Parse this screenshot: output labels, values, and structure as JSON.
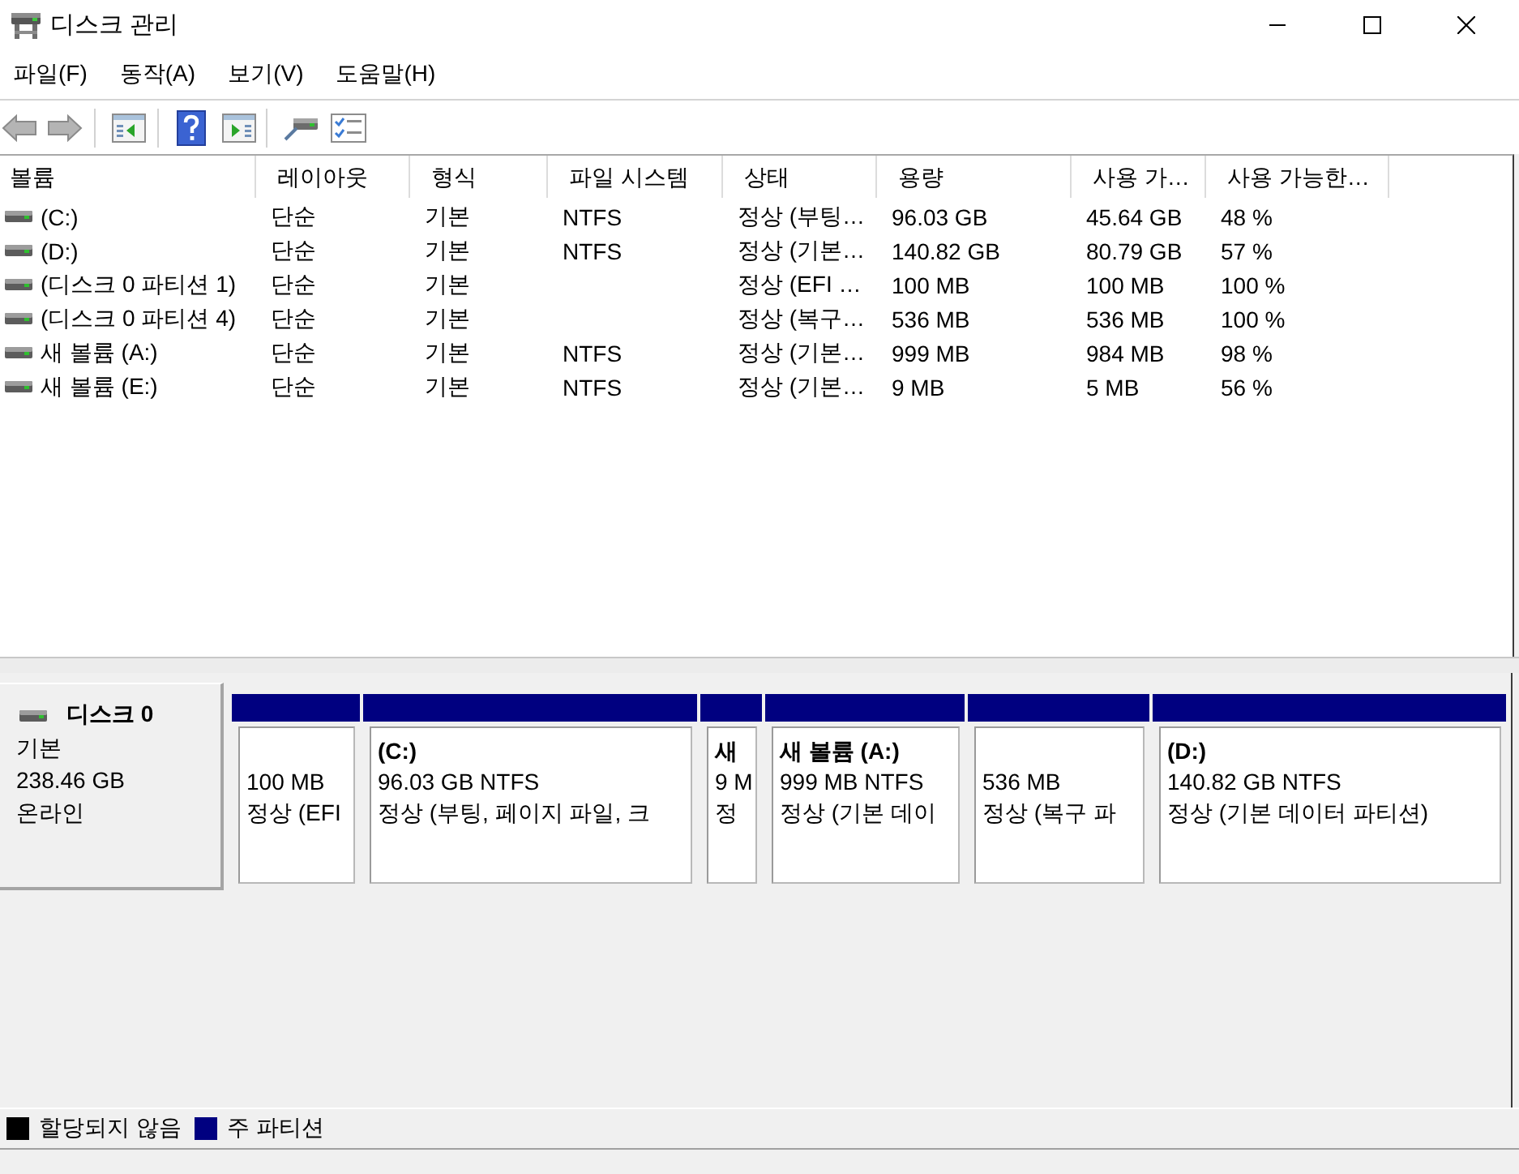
{
  "window": {
    "title": "디스크 관리"
  },
  "menu": [
    "파일(F)",
    "동작(A)",
    "보기(V)",
    "도움말(H)"
  ],
  "volume_table": {
    "columns": [
      "볼륨",
      "레이아웃",
      "형식",
      "파일 시스템",
      "상태",
      "용량",
      "사용 가…",
      "사용 가능한…"
    ],
    "rows": [
      {
        "volume": "(C:)",
        "layout": "단순",
        "type": "기본",
        "file_system": "NTFS",
        "status": "정상 (부팅…",
        "capacity": "96.03 GB",
        "column_7": "45.64 GB",
        "column_8": "48 %",
        "selected": false
      },
      {
        "volume": "(D:)",
        "layout": "단순",
        "type": "기본",
        "file_system": "NTFS",
        "status": "정상 (기본…",
        "capacity": "140.82 GB",
        "column_7": "80.79 GB",
        "column_8": "57 %",
        "selected": false
      },
      {
        "volume": "(디스크 0 파티션 1)",
        "layout": "단순",
        "type": "기본",
        "status": "정상 (EFI …",
        "capacity": "100 MB",
        "column_7": "100 MB",
        "column_8": "100 %",
        "selected": false
      },
      {
        "volume": "(디스크 0 파티션 4)",
        "layout": "단순",
        "type": "기본",
        "status": "정상 (복구…",
        "capacity": "536 MB",
        "column_7": "536 MB",
        "column_8": "100 %",
        "selected": false
      },
      {
        "volume": "새 볼륨 (A:)",
        "layout": "단순",
        "type": "기본",
        "file_system": "NTFS",
        "status": "정상 (기본…",
        "capacity": "999 MB",
        "column_7": "984 MB",
        "column_8": "98 %",
        "selected": false
      },
      {
        "volume": "새 볼륨 (E:)",
        "layout": "단순",
        "type": "기본",
        "file_system": "NTFS",
        "status": "정상 (기본…",
        "capacity": "9 MB",
        "column_7": "5 MB",
        "column_8": "56 %",
        "selected": false
      }
    ]
  },
  "disk": {
    "name": "디스크 0",
    "type": "기본",
    "size": "238.46 GB",
    "status": "온라인",
    "partitions": [
      {
        "kind": "primary",
        "size": "100 MB",
        "status": "정상 (EFI",
        "selected": false
      },
      {
        "kind": "primary",
        "label": "(C:)",
        "size": "96.03 GB NTFS",
        "status": "정상 (부팅, 페이지 파일, 크",
        "selected": false
      },
      {
        "kind": "primary",
        "label": "새",
        "size": "9 M",
        "status": "정",
        "selected": false
      },
      {
        "kind": "primary",
        "label": "새 볼륨 (A:)",
        "size": "999 MB NTFS",
        "status": "정상 (기본 데이",
        "selected": false
      },
      {
        "kind": "primary",
        "size": "536 MB",
        "status": "정상 (복구 파",
        "selected": false
      },
      {
        "kind": "primary",
        "label": "(D:)",
        "size": "140.82 GB NTFS",
        "status": "정상 (기본 데이터 파티션)",
        "selected": false
      }
    ]
  },
  "legend": [
    {
      "label": "할당되지 않음",
      "color": "#000000"
    },
    {
      "label": "주 파티션",
      "color": "#000080"
    }
  ]
}
